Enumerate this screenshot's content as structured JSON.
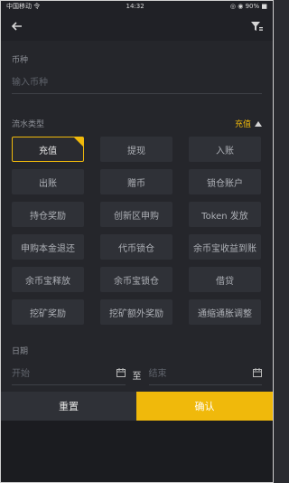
{
  "statusbar": {
    "carrier": "中国移动 令",
    "time": "14:32",
    "battery": "◎ ◉ 90% ■"
  },
  "coin": {
    "label": "币种",
    "placeholder": "输入币种"
  },
  "flow": {
    "label": "流水类型",
    "selected": "充值",
    "items": [
      "充值",
      "提现",
      "入账",
      "出账",
      "赠币",
      "锁仓账户",
      "持仓奖励",
      "创新区申购",
      "Token 发放",
      "申购本金退还",
      "代币锁仓",
      "余币宝收益到账",
      "余币宝释放",
      "余币宝锁仓",
      "借贷",
      "挖矿奖励",
      "挖矿额外奖励",
      "通缩通胀调整"
    ]
  },
  "date": {
    "label": "日期",
    "start": "开始",
    "to": "至",
    "end": "结束"
  },
  "footer": {
    "reset": "重置",
    "confirm": "确认"
  },
  "icons": {
    "back": "arrow-left-icon",
    "filter": "filter-icon",
    "calendar": "calendar-icon",
    "collapse": "triangle-up-icon"
  },
  "colors": {
    "accent": "#f0b90b",
    "background": "#25262b",
    "chip": "#2f3137"
  }
}
